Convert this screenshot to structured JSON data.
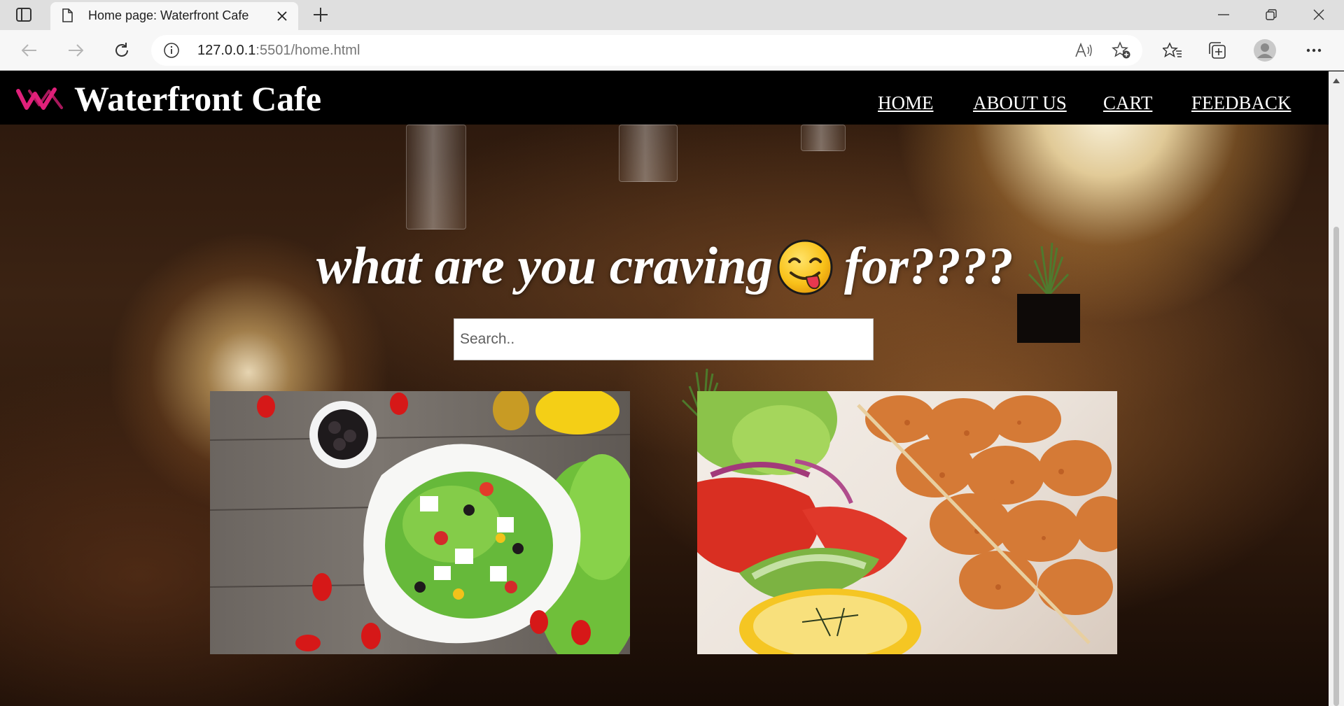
{
  "browser": {
    "tab_title": "Home page: Waterfront Cafe",
    "url_host": "127.0.0.1",
    "url_rest": ":5501/home.html",
    "icons": [
      "sidebar-icon",
      "page-icon",
      "close-icon",
      "plus-icon",
      "minimize-icon",
      "restore-icon",
      "close-window-icon",
      "back-icon",
      "forward-icon",
      "refresh-icon",
      "info-icon",
      "read-aloud-icon",
      "add-favorite-icon",
      "favorites-icon",
      "collections-icon",
      "profile-icon",
      "more-icon"
    ]
  },
  "site": {
    "brand": "Waterfront Cafe",
    "brand_color": "#e0207a",
    "nav": [
      "HOME",
      "ABOUT US",
      "CART",
      "FEEDBACK"
    ],
    "headline": "what are you craving",
    "headline_emoji": "face-savoring-food",
    "headline_tail": "for????",
    "search_placeholder": "Search..",
    "food_images": [
      "salad",
      "chicken-skewers"
    ]
  }
}
